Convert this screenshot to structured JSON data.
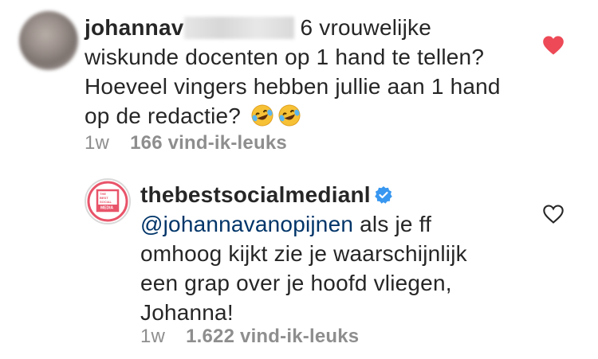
{
  "comment1": {
    "username": "johannav",
    "text_after_username": "6 vrouwelijke",
    "lines": [
      "wiskunde docenten op 1 hand te tellen?",
      "Hoeveel vingers hebben jullie aan 1 hand",
      "op de redactie?"
    ],
    "emoji": "rolling-on-floor-laughing",
    "time": "1w",
    "likes": "166 vind-ik-leuks",
    "liked": true,
    "heart_color": "#ed4956"
  },
  "comment2": {
    "username": "thebestsocialmedianl",
    "verified": true,
    "verified_color": "#3897f0",
    "mention": "@johannavanopijnen",
    "first_line_rest": "als je ff",
    "lines": [
      "omhoog kijkt zie je waarschijnlijk",
      "een grap over je hoofd vliegen,",
      "Johanna!"
    ],
    "time": "1w",
    "likes": "1.622 vind-ik-leuks",
    "liked": false,
    "avatar_logo_text": [
      "THE",
      "BEST",
      "SOCIAL",
      "MEDIA"
    ],
    "brand_color": "#e8546a"
  }
}
